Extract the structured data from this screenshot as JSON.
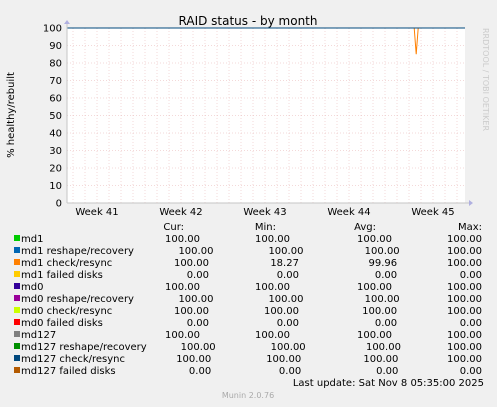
{
  "chart_data": {
    "type": "line",
    "title": "RAID status - by month",
    "ylabel": "% healthy/rebuilt",
    "side_label": "RRDTOOL / TOBI OETIKER",
    "ylim": [
      0,
      100
    ],
    "yticks": [
      "0",
      "10",
      "20",
      "30",
      "40",
      "50",
      "60",
      "70",
      "80",
      "90",
      "100"
    ],
    "xticks": [
      "Week 41",
      "Week 42",
      "Week 43",
      "Week 44",
      "Week 45"
    ],
    "x": [
      "Week 41",
      "Week 42",
      "Week 43",
      "Week 44",
      "Week 45"
    ],
    "dip": {
      "series": "md1 check/resync",
      "week": 44.8,
      "value": 85
    },
    "table_headers": [
      "Cur:",
      "Min:",
      "Avg:",
      "Max:"
    ],
    "series": [
      {
        "name": "md1",
        "color": "#00cc00",
        "stats": [
          "100.00",
          "100.00",
          "100.00",
          "100.00"
        ],
        "values": [
          100,
          100,
          100,
          100,
          100
        ]
      },
      {
        "name": "md1 reshape/recovery",
        "color": "#0066b3",
        "stats": [
          "100.00",
          "100.00",
          "100.00",
          "100.00"
        ],
        "values": [
          100,
          100,
          100,
          100,
          100
        ]
      },
      {
        "name": "md1 check/resync",
        "color": "#ff8000",
        "stats": [
          "100.00",
          "18.27",
          "99.96",
          "100.00"
        ],
        "values": [
          100,
          100,
          100,
          100,
          100
        ]
      },
      {
        "name": "md1 failed disks",
        "color": "#ffcc00",
        "stats": [
          "0.00",
          "0.00",
          "0.00",
          "0.00"
        ],
        "values": [
          0,
          0,
          0,
          0,
          0
        ]
      },
      {
        "name": "md0",
        "color": "#330099",
        "stats": [
          "100.00",
          "100.00",
          "100.00",
          "100.00"
        ],
        "values": [
          100,
          100,
          100,
          100,
          100
        ]
      },
      {
        "name": "md0 reshape/recovery",
        "color": "#990099",
        "stats": [
          "100.00",
          "100.00",
          "100.00",
          "100.00"
        ],
        "values": [
          100,
          100,
          100,
          100,
          100
        ]
      },
      {
        "name": "md0 check/resync",
        "color": "#ccff00",
        "stats": [
          "100.00",
          "100.00",
          "100.00",
          "100.00"
        ],
        "values": [
          100,
          100,
          100,
          100,
          100
        ]
      },
      {
        "name": "md0 failed disks",
        "color": "#ff0000",
        "stats": [
          "0.00",
          "0.00",
          "0.00",
          "0.00"
        ],
        "values": [
          0,
          0,
          0,
          0,
          0
        ]
      },
      {
        "name": "md127",
        "color": "#808080",
        "stats": [
          "100.00",
          "100.00",
          "100.00",
          "100.00"
        ],
        "values": [
          100,
          100,
          100,
          100,
          100
        ]
      },
      {
        "name": "md127 reshape/recovery",
        "color": "#008f00",
        "stats": [
          "100.00",
          "100.00",
          "100.00",
          "100.00"
        ],
        "values": [
          100,
          100,
          100,
          100,
          100
        ]
      },
      {
        "name": "md127 check/resync",
        "color": "#00487d",
        "stats": [
          "100.00",
          "100.00",
          "100.00",
          "100.00"
        ],
        "values": [
          100,
          100,
          100,
          100,
          100
        ]
      },
      {
        "name": "md127 failed disks",
        "color": "#b35a00",
        "stats": [
          "0.00",
          "0.00",
          "0.00",
          "0.00"
        ],
        "values": [
          0,
          0,
          0,
          0,
          0
        ]
      }
    ],
    "last_update": "Last update: Sat Nov  8 05:35:00 2025",
    "footer": "Munin 2.0.76",
    "colors": {
      "background": "#f0f0f0",
      "plot": "#ffffff",
      "grid": "#e7b3b3",
      "axis": "#c6c6c6"
    }
  }
}
